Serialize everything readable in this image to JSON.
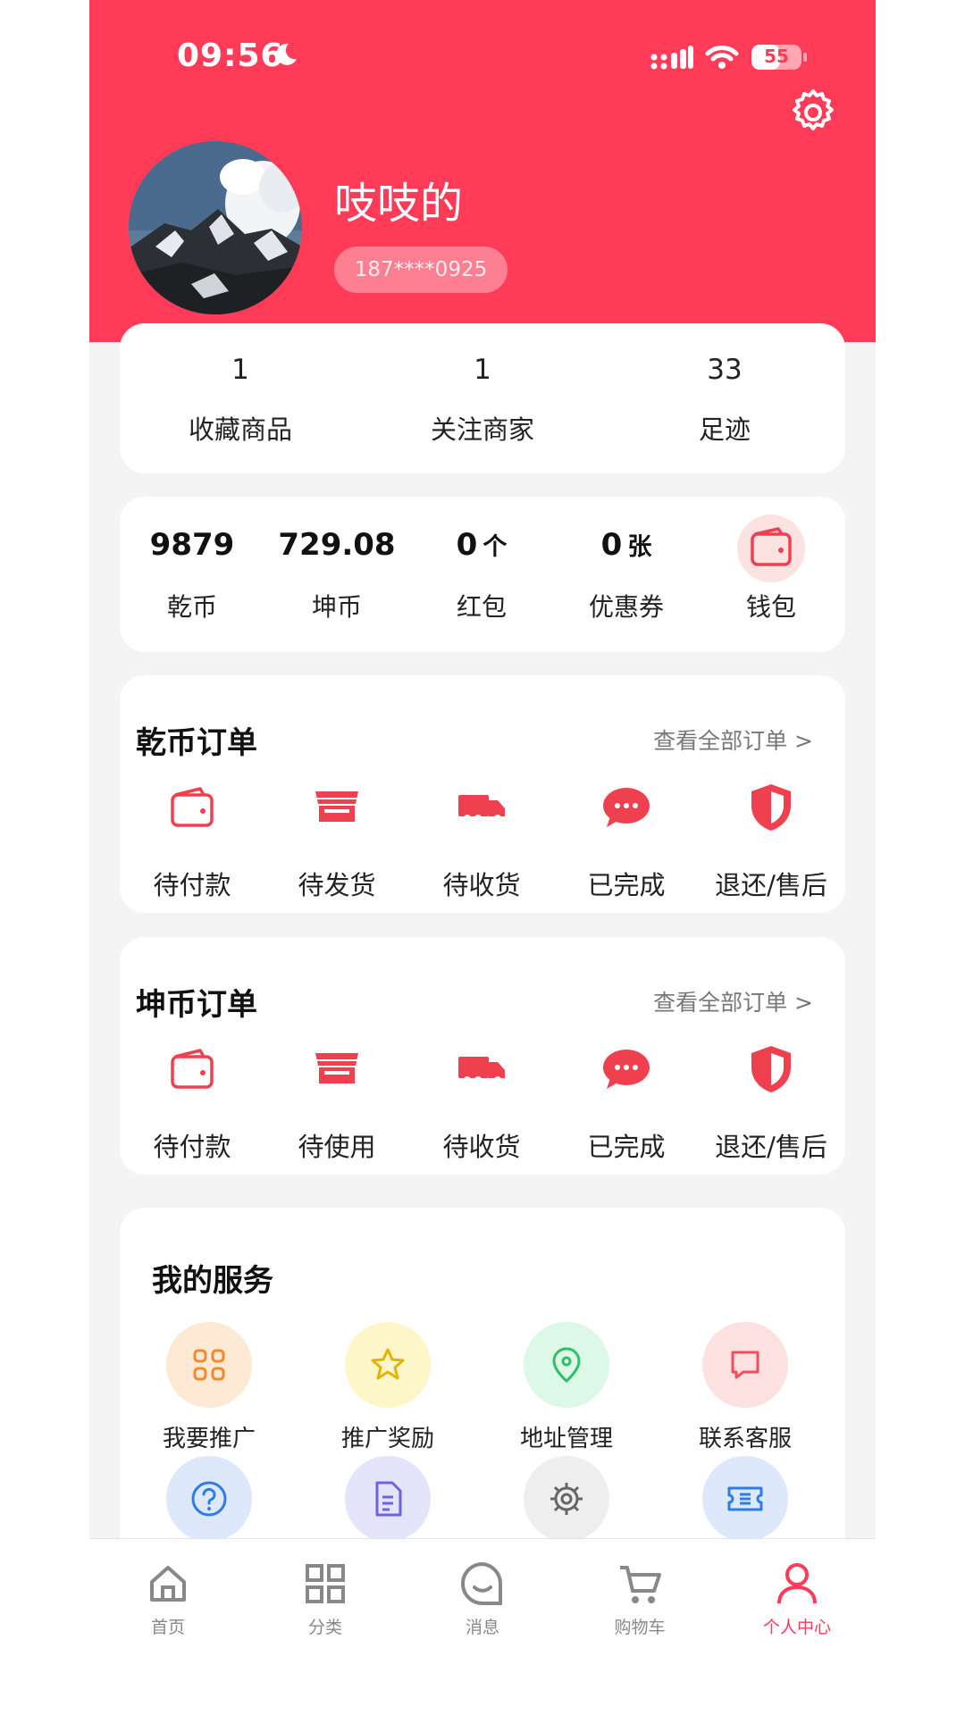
{
  "status_bar": {
    "time": "09:56",
    "battery": "55"
  },
  "profile": {
    "name": "吱吱的",
    "phone": "187****0925"
  },
  "stats": [
    {
      "value": "1",
      "label": "收藏商品"
    },
    {
      "value": "1",
      "label": "关注商家"
    },
    {
      "value": "33",
      "label": "足迹"
    }
  ],
  "assets": [
    {
      "value": "9879",
      "unit": "",
      "label": "乾币"
    },
    {
      "value": "729.08",
      "unit": "",
      "label": "坤币"
    },
    {
      "value": "0",
      "unit": "个",
      "label": "红包"
    },
    {
      "value": "0",
      "unit": "张",
      "label": "优惠券"
    },
    {
      "value": "",
      "unit": "",
      "label": "钱包",
      "icon": "wallet-icon"
    }
  ],
  "qian_orders": {
    "title": "乾币订单",
    "more": "查看全部订单 >",
    "items": [
      {
        "label": "待付款",
        "icon": "wallet-icon"
      },
      {
        "label": "待发货",
        "icon": "store-icon"
      },
      {
        "label": "待收货",
        "icon": "truck-icon"
      },
      {
        "label": "已完成",
        "icon": "chat-bubble-icon"
      },
      {
        "label": "退还/售后",
        "icon": "shield-icon"
      }
    ]
  },
  "kun_orders": {
    "title": "坤币订单",
    "more": "查看全部订单 >",
    "items": [
      {
        "label": "待付款",
        "icon": "wallet-icon"
      },
      {
        "label": "待使用",
        "icon": "store-icon"
      },
      {
        "label": "待收货",
        "icon": "truck-icon"
      },
      {
        "label": "已完成",
        "icon": "chat-bubble-icon"
      },
      {
        "label": "退还/售后",
        "icon": "shield-icon"
      }
    ]
  },
  "services": {
    "title": "我的服务",
    "items": [
      {
        "label": "我要推广",
        "icon": "grid-icon",
        "bg": "#fde9d4",
        "color": "#f08a2c"
      },
      {
        "label": "推广奖励",
        "icon": "star-icon",
        "bg": "#fdf6c8",
        "color": "#e0b400"
      },
      {
        "label": "地址管理",
        "icon": "location-pin-icon",
        "bg": "#dcf8e6",
        "color": "#2fbf6a"
      },
      {
        "label": "联系客服",
        "icon": "message-icon",
        "bg": "#fde0e0",
        "color": "#ef4f58"
      },
      {
        "label": "",
        "icon": "help-icon",
        "bg": "#dde9fb",
        "color": "#2f7be8"
      },
      {
        "label": "",
        "icon": "document-icon",
        "bg": "#e4e4fb",
        "color": "#6b63e6"
      },
      {
        "label": "",
        "icon": "gear-icon",
        "bg": "#eeeeee",
        "color": "#666666"
      },
      {
        "label": "",
        "icon": "ticket-icon",
        "bg": "#dde9fb",
        "color": "#2f7be8"
      }
    ]
  },
  "tabbar": [
    {
      "label": "首页",
      "icon": "home-icon"
    },
    {
      "label": "分类",
      "icon": "category-icon"
    },
    {
      "label": "消息",
      "icon": "message-smile-icon"
    },
    {
      "label": "购物车",
      "icon": "cart-icon"
    },
    {
      "label": "个人中心",
      "icon": "user-icon",
      "active": true
    }
  ],
  "colors": {
    "brand": "#ff3b58",
    "icon_red": "#ef4050",
    "text": "#222222"
  }
}
